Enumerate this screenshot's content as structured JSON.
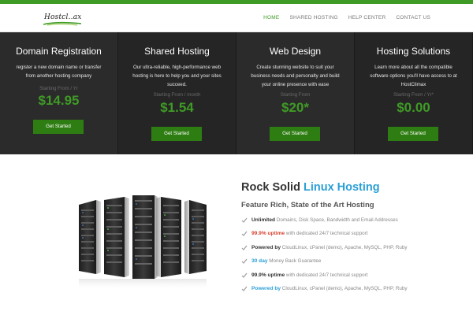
{
  "brand": {
    "logo_text": "Hostcl..ax",
    "accent": "#3f9a26"
  },
  "nav": {
    "items": [
      {
        "label": "HOME",
        "active": true
      },
      {
        "label": "SHARED HOSTING",
        "active": false
      },
      {
        "label": "HELP CENTER",
        "active": false
      },
      {
        "label": "CONTACT US",
        "active": false
      }
    ]
  },
  "plans": [
    {
      "title": "Domain Registration",
      "desc": "register a new domain name or transfer from another hosting company",
      "from": "Starting From / Yr",
      "price": "$14.95",
      "button": "Get Started"
    },
    {
      "title": "Shared Hosting",
      "desc": "Our ultra-reliable, high-performance web hosting is here to help you and your sites succeed.",
      "from": "Starting From / month",
      "price": "$1.54",
      "button": "Get Started"
    },
    {
      "title": "Web Design",
      "desc": "Create stunning website to suit your business needs and personalty and build your online presence with ease",
      "from": "Starting From",
      "price": "$20*",
      "button": "Get Started"
    },
    {
      "title": "Hosting Solutions",
      "desc": "Learn more about all the compatible software options you'll have access to at HostClimax",
      "from": "Starting From / Yr*",
      "price": "$0.00",
      "button": "Get Started"
    }
  ],
  "features": {
    "title_main": "Rock Solid ",
    "title_highlight": "Linux Hosting",
    "subtitle": "Feature Rich, State of the Art Hosting",
    "items": [
      {
        "strong": "Unlimited",
        "rest": " Domains, Disk Space, Bandwidth and Email Addresses",
        "color": "dark"
      },
      {
        "strong": "99.9% uptime",
        "rest": " with dedicated 24/7 technical support",
        "color": "red"
      },
      {
        "strong": "Powered by",
        "rest": " CloudLinux, cPanel (demo), Apache, MySQL, PHP, Ruby",
        "color": "dark"
      },
      {
        "strong": "30 day",
        "rest": " Money Back Guarantee",
        "color": "blue"
      },
      {
        "strong": "99.9% uptime",
        "rest": " with dedicated 24/7 technical support",
        "color": "dark"
      },
      {
        "strong": "Powered by",
        "rest": " CloudLinux, cPanel (demo), Apache, MySQL, PHP, Ruby",
        "color": "blue"
      }
    ]
  }
}
